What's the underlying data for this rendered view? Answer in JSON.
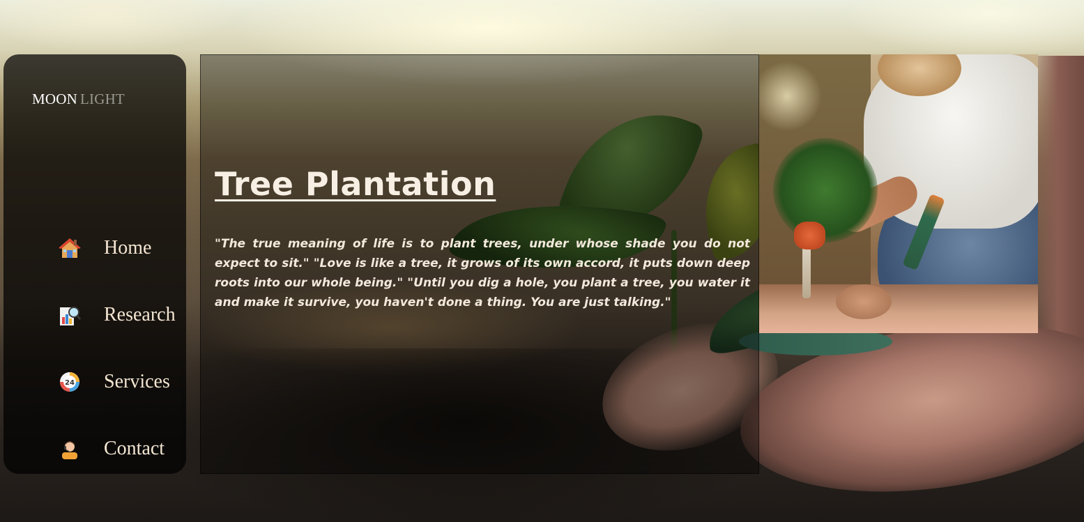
{
  "brand": {
    "word1": "MOON",
    "word2": "LIGHT"
  },
  "nav": {
    "items": [
      {
        "label": "Home",
        "icon": "house-icon"
      },
      {
        "label": "Research",
        "icon": "research-chart-icon"
      },
      {
        "label": "Services",
        "icon": "24-hour-service-icon"
      },
      {
        "label": "Contact",
        "icon": "contact-person-icon"
      }
    ]
  },
  "content": {
    "title": "Tree Plantation",
    "quote": "\"The true meaning of life is to plant trees, under whose shade you do not expect to sit.\" \"Love is like a tree, it grows of its own accord, it puts down deep roots into our whole being.\" \"Until you dig a hole, you plant a tree, you water it and make it survive, you haven't done a thing. You are just talking.\""
  },
  "colors": {
    "nav_text": "#f4e6d2",
    "brand_primary": "#ffffff",
    "brand_secondary": "#9a9a92",
    "content_text": "#f3e9dc"
  }
}
